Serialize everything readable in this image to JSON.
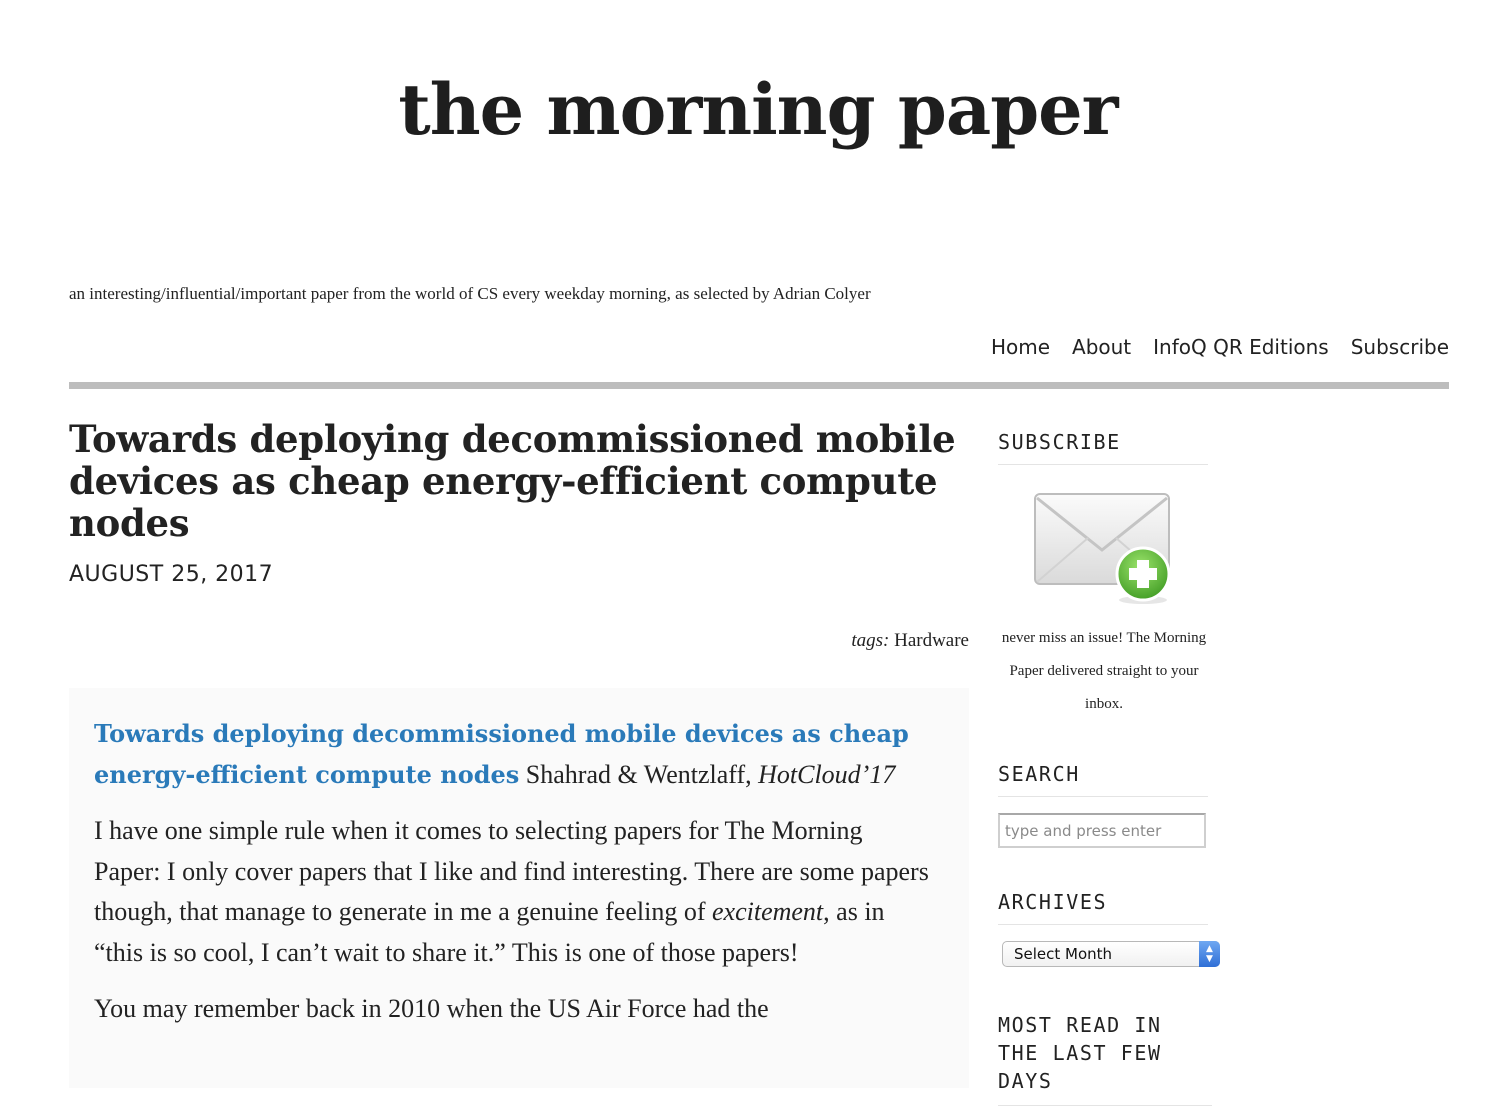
{
  "site": {
    "title": "the morning paper",
    "tagline": "an interesting/influential/important paper from the world of CS every weekday morning, as selected by Adrian Colyer"
  },
  "nav": {
    "items": [
      {
        "label": "Home"
      },
      {
        "label": "About"
      },
      {
        "label": "InfoQ QR Editions"
      },
      {
        "label": "Subscribe"
      }
    ]
  },
  "post": {
    "title": "Towards deploying decommissioned mobile devices as cheap energy-efficient compute nodes",
    "date": "AUGUST 25, 2017",
    "tags_label": "tags:",
    "tag": "Hardware",
    "paper_link": "Towards deploying decommissioned mobile devices as cheap energy-efficient compute nodes",
    "authors": "Shahrad & Wentzlaff,",
    "venue": "HotCloud’17",
    "para1_a": "I have one simple rule when it comes to selecting papers for The Morning Paper: I only cover papers that I like and find interesting. There are some papers though, that manage to generate in me a genuine feeling of",
    "para1_em": "excitement",
    "para1_b": ", as in “this is so cool, I can’t wait to share it.” This is one of those papers!",
    "para2": "You may remember back in 2010 when the US Air Force had the"
  },
  "sidebar": {
    "subscribe_title": "SUBSCRIBE",
    "subscribe_text": "never miss an issue! The Morning Paper delivered straight to your inbox.",
    "search_title": "SEARCH",
    "search_placeholder": "type and press enter",
    "archives_title": "ARCHIVES",
    "archives_select": "Select Month",
    "most_read_title": "MOST READ IN THE LAST FEW DAYS"
  },
  "icons": {
    "subscribe": "envelope-plus-icon",
    "select": "updown-arrows-icon"
  },
  "colors": {
    "link": "#2a7ab9",
    "rule": "#bdbdbd",
    "select_accent": "#2f6fd6",
    "plus_badge": "#5fbf3a"
  }
}
